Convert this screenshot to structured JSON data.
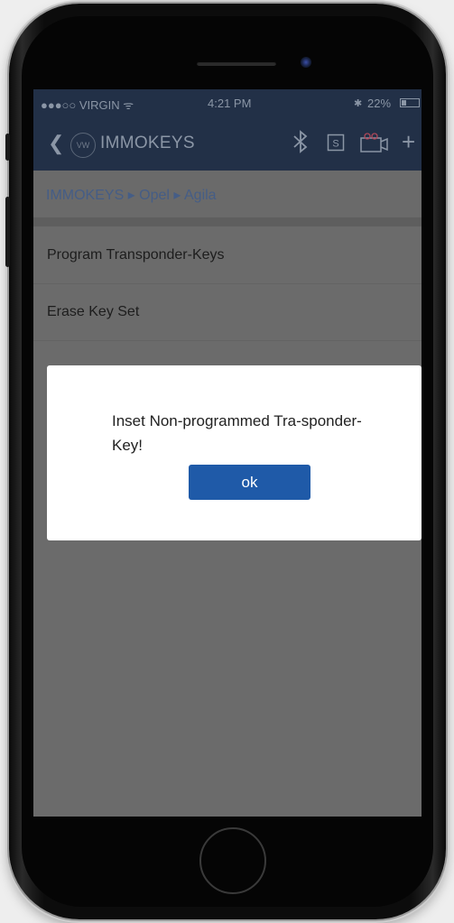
{
  "status_bar": {
    "carrier": "●●●○○ VIRGIN ᯤ",
    "time": "4:21 PM",
    "bluetooth": "✱",
    "battery": "22%"
  },
  "nav": {
    "back_icon": "chevron-left",
    "logo": "VW",
    "title": "IMMOKEYS",
    "icons": [
      "bluetooth-icon",
      "s-box-icon",
      "camera-icon",
      "plus-icon"
    ]
  },
  "breadcrumb": "IMMOKEYS ▸ Opel ▸ Agila",
  "list": {
    "items": [
      "Program Transponder-Keys",
      "Erase Key Set"
    ]
  },
  "dialog": {
    "message": "Inset Non-programmed Tra-sponder-Key!",
    "ok_label": "ok"
  },
  "colors": {
    "navbar": "#223047",
    "ok_button": "#1f5aa8",
    "screen_dim": "#6b6b6b"
  }
}
